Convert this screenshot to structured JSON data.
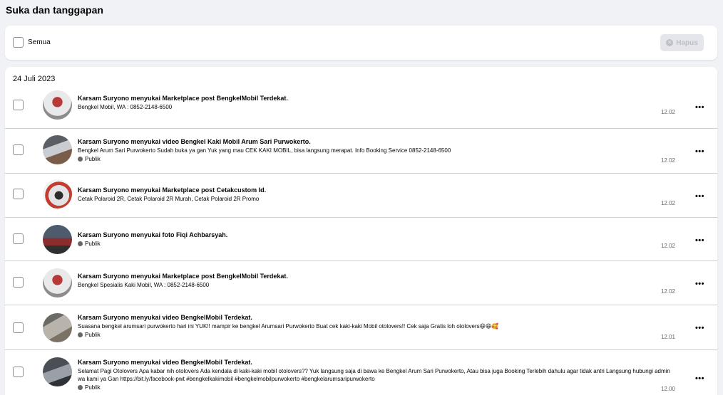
{
  "header": {
    "title": "Suka dan tanggapan"
  },
  "toolbar": {
    "select_all_label": "Semua",
    "delete_label": "Hapus"
  },
  "list": {
    "date": "24 Juli 2023",
    "items": [
      {
        "title": "Karsam Suryono menyukai Marketplace post BengkelMobil Terdekat.",
        "desc": "Bengkel Mobil, WA : 0852-2148-6500",
        "privacy": "",
        "time": "12.02"
      },
      {
        "title": "Karsam Suryono menyukai video Bengkel Kaki Mobil Arum Sari Purwokerto.",
        "desc": "Bengkel Arum Sari Purwokerto Sudah buka ya gan Yuk yang mau CEK KAKI MOBIL, bisa langsung merapat. Info Booking Service 0852-2148-6500",
        "privacy": "Publik",
        "time": "12.02"
      },
      {
        "title": "Karsam Suryono menyukai Marketplace post Cetakcustom Id.",
        "desc": "Cetak Polaroid 2R, Cetak Polaroid 2R Murah, Cetak Polaroid 2R Promo",
        "privacy": "",
        "time": "12.02"
      },
      {
        "title": "Karsam Suryono menyukai foto Fiqi Achbarsyah.",
        "desc": "",
        "privacy": "Publik",
        "time": "12.02"
      },
      {
        "title": "Karsam Suryono menyukai Marketplace post BengkelMobil Terdekat.",
        "desc": "Bengkel Spesialis Kaki Mobil, WA : 0852-2148-6500",
        "privacy": "",
        "time": "12.02"
      },
      {
        "title": "Karsam Suryono menyukai video BengkelMobil Terdekat.",
        "desc": "Suasana bengkel arumsari purwokerto hari ini YUK!! mampir ke bengkel Arumsari Purwokerto Buat cek kaki-kaki Mobil otolovers!! Cek saja Gratis loh otolovers😆😆🥰",
        "privacy": "Publik",
        "time": "12.01"
      },
      {
        "title": "Karsam Suryono menyukai video BengkelMobil Terdekat.",
        "desc": "Selamat Pagi Otolovers Apa kabar nih otolovers Ada kendala di kaki-kaki mobil otolovers?? Yuk langsung saja di bawa ke Bengkel Arum Sari Purwokerto, Atau bisa juga Booking Terlebih dahulu agar tidak antri Langsung hubungi admin wa kami ya Gan https://bit.ly/facebook-pwt #bengkelkakimobil #bengkelmobilpurwokerto #bengkelarumsaripurwokerto",
        "privacy": "Publik",
        "time": "12.00"
      }
    ]
  },
  "colors": {
    "divider": "#ced0d4",
    "muted": "#65676b",
    "card": "#ffffff",
    "background": "#f0f2f5"
  },
  "icons": {
    "more": "ellipsis-icon",
    "privacy": "globe-icon",
    "delete": "close-circle-icon"
  }
}
